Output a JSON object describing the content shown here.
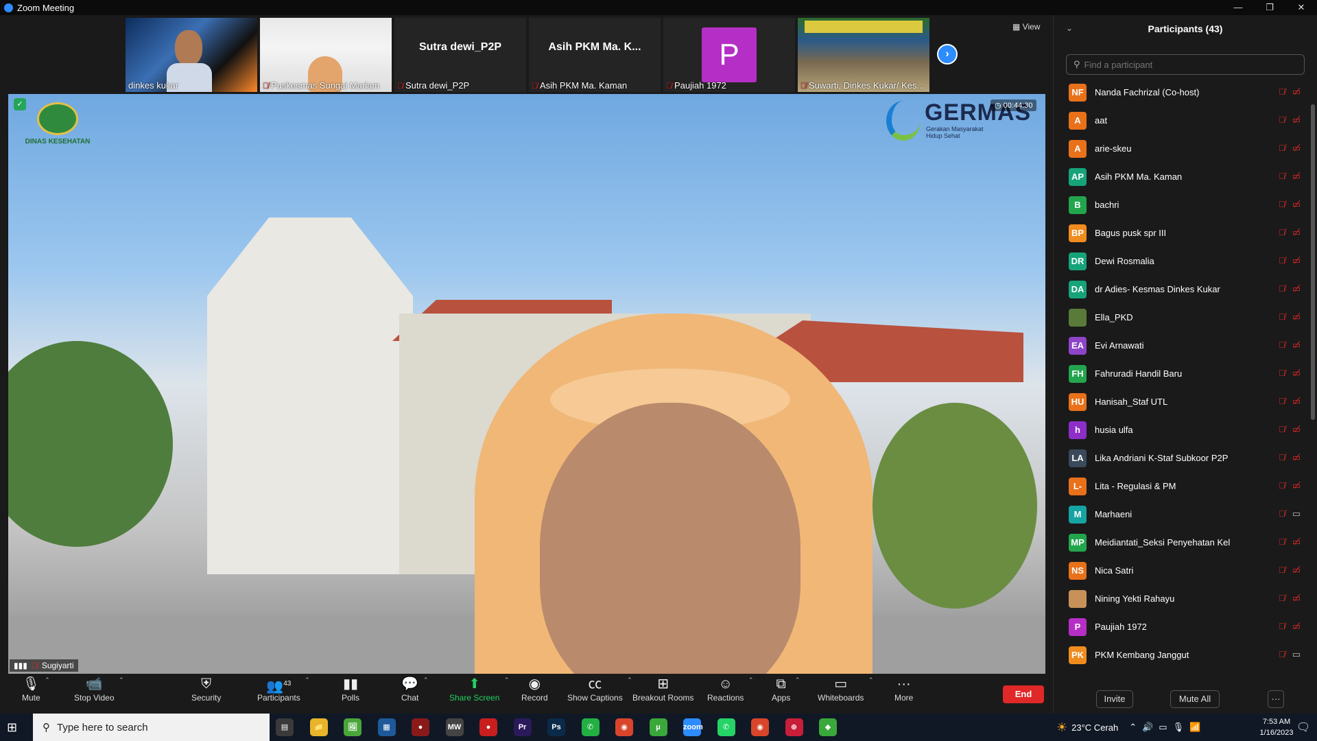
{
  "window": {
    "title": "Zoom Meeting",
    "controls": [
      "—",
      "❐",
      "✕"
    ]
  },
  "strip": {
    "tiles": [
      {
        "name": "dinkes kukar",
        "muted": false
      },
      {
        "name": "Puskesmas Sungai Mariam",
        "muted": true
      },
      {
        "name": "Sutra dewi_P2P",
        "center": "Sutra dewi_P2P",
        "muted": true
      },
      {
        "name": "Asih PKM Ma. Kaman",
        "center": "Asih PKM Ma. K...",
        "muted": true
      },
      {
        "name": "Paujiah 1972",
        "avatar": "P",
        "muted": true
      },
      {
        "name": "Suwarti, Dinkes Kukar/ Kes...",
        "muted": true
      }
    ],
    "view_label": "View"
  },
  "main_video": {
    "speaker": "Sugiyarti",
    "timer": "00:44:30",
    "logo_text": "DINAS KESEHATAN",
    "germas": {
      "title": "GERMAS",
      "sub1": "Gerakan Masyarakat",
      "sub2": "Hidup Sehat"
    }
  },
  "toolbar": {
    "mute": "Mute",
    "stop_video": "Stop Video",
    "security": "Security",
    "participants": "Participants",
    "participants_count": "43",
    "polls": "Polls",
    "chat": "Chat",
    "share_screen": "Share Screen",
    "record": "Record",
    "show_captions": "Show Captions",
    "breakout_rooms": "Breakout Rooms",
    "reactions": "Reactions",
    "apps": "Apps",
    "whiteboards": "Whiteboards",
    "more": "More",
    "end": "End"
  },
  "panel": {
    "title": "Participants (43)",
    "search_placeholder": "Find a participant",
    "participants": [
      {
        "initials": "NF",
        "name": "Nanda Fachrizal (Co-host)",
        "color": "#e8711a",
        "video": false
      },
      {
        "initials": "A",
        "name": "aat",
        "color": "#e8711a",
        "video": false
      },
      {
        "initials": "A",
        "name": "arie-skeu",
        "color": "#e8711a",
        "video": false
      },
      {
        "initials": "AP",
        "name": "Asih PKM Ma. Kaman",
        "color": "#16a37a",
        "video": false
      },
      {
        "initials": "B",
        "name": "bachri",
        "color": "#23a54e",
        "video": false
      },
      {
        "initials": "BP",
        "name": "Bagus  pusk spr III",
        "color": "#f08c1e",
        "video": false
      },
      {
        "initials": "DR",
        "name": "Dewi Rosmalia",
        "color": "#16a37a",
        "video": false
      },
      {
        "initials": "DA",
        "name": "dr Adies- Kesmas Dinkes Kukar",
        "color": "#16a37a",
        "video": false
      },
      {
        "initials": "",
        "name": "Ella_PKD",
        "color": "#5a7a3a",
        "video": false
      },
      {
        "initials": "EA",
        "name": "Evi Arnawati",
        "color": "#8e44c9",
        "video": false
      },
      {
        "initials": "FH",
        "name": "Fahruradi Handil Baru",
        "color": "#23a54e",
        "video": false
      },
      {
        "initials": "HU",
        "name": "Hanisah_Staf UTL",
        "color": "#e8711a",
        "video": false
      },
      {
        "initials": "h",
        "name": "husia ulfa",
        "color": "#8e2ec9",
        "video": false
      },
      {
        "initials": "LA",
        "name": "Lika Andriani K-Staf Subkoor P2P",
        "color": "#3a4a5a",
        "video": false
      },
      {
        "initials": "L-",
        "name": "Lita - Regulasi & PM",
        "color": "#e8711a",
        "video": false
      },
      {
        "initials": "M",
        "name": "Marhaeni",
        "color": "#16a3a3",
        "video": true
      },
      {
        "initials": "MP",
        "name": "Meidiantati_Seksi Penyehatan Kel",
        "color": "#23a54e",
        "video": false
      },
      {
        "initials": "NS",
        "name": "Nica Satri",
        "color": "#e8711a",
        "video": false
      },
      {
        "initials": "",
        "name": "Nining Yekti Rahayu",
        "color": "#c8915a",
        "video": false
      },
      {
        "initials": "P",
        "name": "Paujiah 1972",
        "color": "#b52fc6",
        "video": false
      },
      {
        "initials": "PK",
        "name": "PKM Kembang Janggut",
        "color": "#f08c1e",
        "video": true
      }
    ],
    "invite": "Invite",
    "mute_all": "Mute All",
    "more": "···"
  },
  "taskbar": {
    "search_placeholder": "Type here to search",
    "weather": "23°C  Cerah",
    "time": "7:53 AM",
    "date": "1/16/2023",
    "apps": [
      {
        "label": "▤",
        "color": "#3a3a3a"
      },
      {
        "label": "📁",
        "color": "#e8b42a"
      },
      {
        "label": "🖼",
        "color": "#4aa63a"
      },
      {
        "label": "▦",
        "color": "#1e5a9a"
      },
      {
        "label": "●",
        "color": "#8a1a1a"
      },
      {
        "label": "MW",
        "color": "#444"
      },
      {
        "label": "●",
        "color": "#c81e1e"
      },
      {
        "label": "Pr",
        "color": "#2a1a5a"
      },
      {
        "label": "Ps",
        "color": "#0b2a4a"
      },
      {
        "label": "✆",
        "color": "#23b043"
      },
      {
        "label": "◉",
        "color": "#d8452a"
      },
      {
        "label": "μ",
        "color": "#3aa83a"
      },
      {
        "label": "zoom",
        "color": "#2d8cff"
      },
      {
        "label": "✆",
        "color": "#25d366"
      },
      {
        "label": "◉",
        "color": "#d8452a"
      },
      {
        "label": "⊕",
        "color": "#c81e3a"
      },
      {
        "label": "◆",
        "color": "#3aa83a"
      }
    ]
  }
}
